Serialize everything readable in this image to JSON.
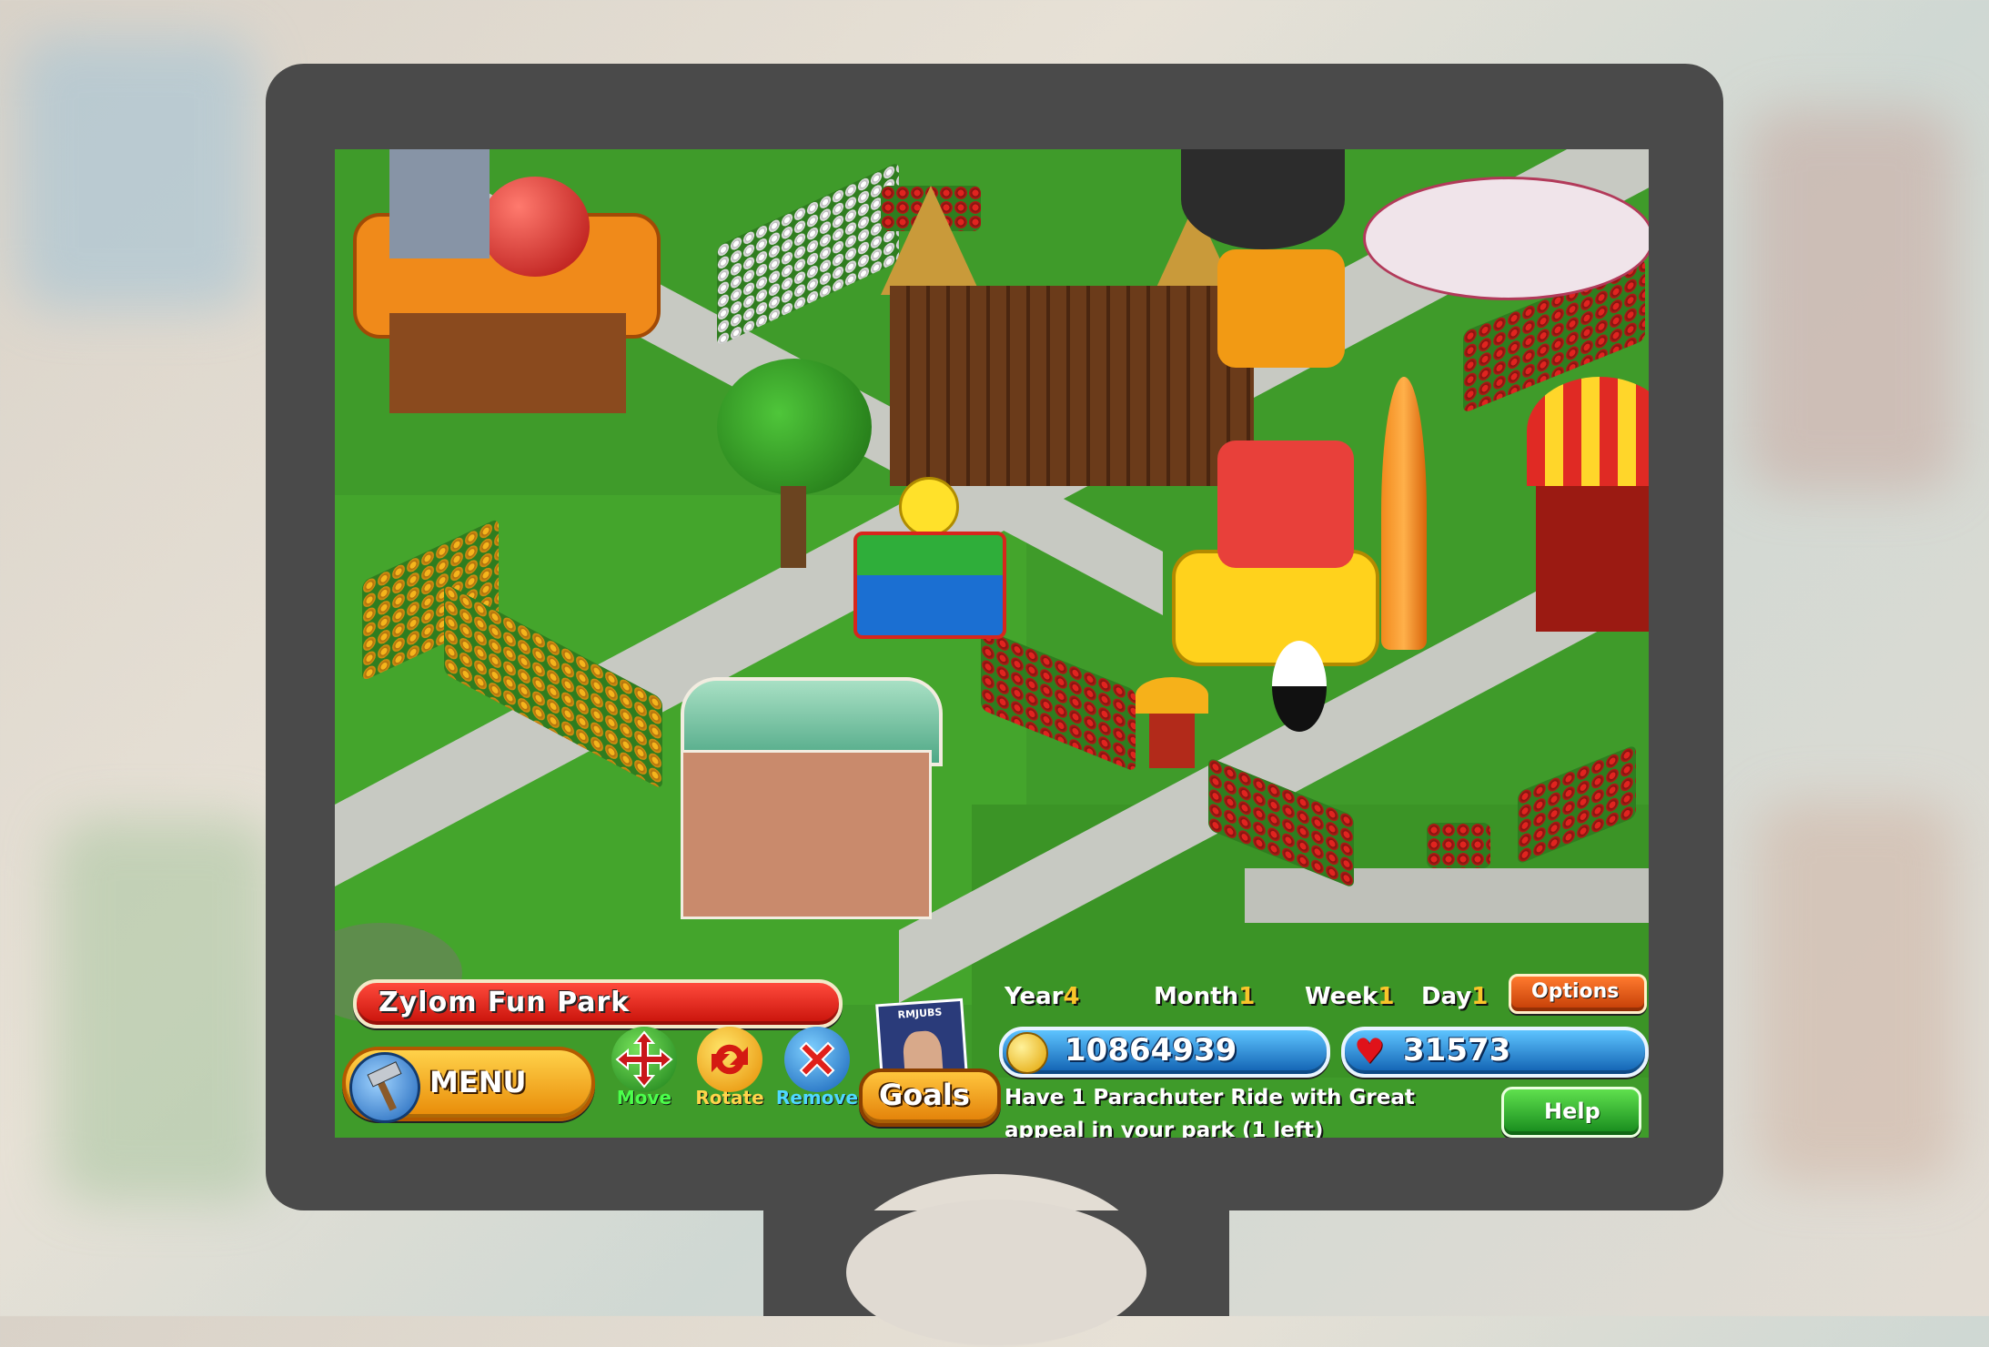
{
  "park": {
    "name": "Zylom Fun Park"
  },
  "toolbar": {
    "menu_label": "MENU",
    "move_label": "Move",
    "rotate_label": "Rotate",
    "remove_label": "Remove",
    "goals_label": "Goals",
    "options_label": "Options",
    "help_label": "Help",
    "magazine_title": "RMJUBS"
  },
  "date": {
    "year_label": "Year",
    "year": "4",
    "month_label": "Month",
    "month": "1",
    "week_label": "Week",
    "week": "1",
    "day_label": "Day",
    "day": "1"
  },
  "stats": {
    "money": "10864939",
    "hearts": "31573"
  },
  "goal": {
    "line1": "Have 1 Parachuter Ride with Great",
    "line2": "appeal in your park (1 left)"
  },
  "colors": {
    "grass": "#3f9b2a",
    "path": "#c7c9c2",
    "bezel": "#4a4a4a",
    "hud_blue": "#1e7ad6",
    "hud_red": "#e2261b"
  },
  "icons": [
    "hammer-icon",
    "move-arrows-icon",
    "rotate-icon",
    "remove-x-icon",
    "coin-icon",
    "heart-icon"
  ]
}
